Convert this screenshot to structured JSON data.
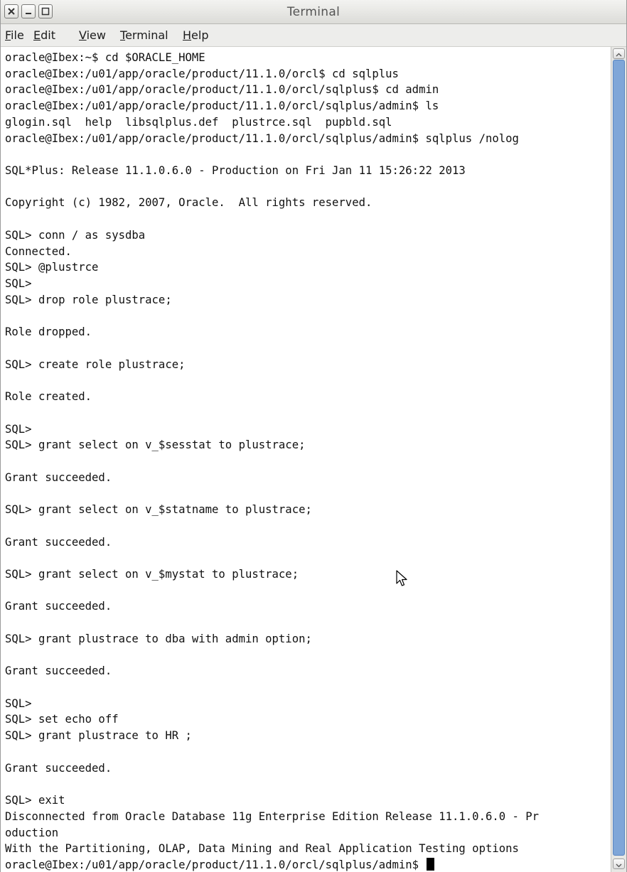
{
  "window": {
    "title": "Terminal"
  },
  "menu": {
    "items": [
      {
        "mnemonic": "F",
        "rest": "ile"
      },
      {
        "mnemonic": "E",
        "rest": "dit"
      },
      {
        "mnemonic": "V",
        "rest": "iew"
      },
      {
        "mnemonic": "T",
        "rest": "erminal"
      },
      {
        "mnemonic": "H",
        "rest": "elp"
      }
    ]
  },
  "icons": {
    "close": "close-icon",
    "minimize": "minimize-icon",
    "maximize": "maximize-icon",
    "pointer": "mouse-pointer-icon"
  },
  "colors": {
    "scrollbar_thumb": "#7fa6d8",
    "terminal_background": "#ffffff",
    "terminal_text": "#111111"
  },
  "terminal": {
    "lines": [
      "oracle@Ibex:~$ cd $ORACLE_HOME",
      "oracle@Ibex:/u01/app/oracle/product/11.1.0/orcl$ cd sqlplus",
      "oracle@Ibex:/u01/app/oracle/product/11.1.0/orcl/sqlplus$ cd admin",
      "oracle@Ibex:/u01/app/oracle/product/11.1.0/orcl/sqlplus/admin$ ls",
      "glogin.sql  help  libsqlplus.def  plustrce.sql  pupbld.sql",
      "oracle@Ibex:/u01/app/oracle/product/11.1.0/orcl/sqlplus/admin$ sqlplus /nolog",
      "",
      "SQL*Plus: Release 11.1.0.6.0 - Production on Fri Jan 11 15:26:22 2013",
      "",
      "Copyright (c) 1982, 2007, Oracle.  All rights reserved.",
      "",
      "SQL> conn / as sysdba",
      "Connected.",
      "SQL> @plustrce",
      "SQL>",
      "SQL> drop role plustrace;",
      "",
      "Role dropped.",
      "",
      "SQL> create role plustrace;",
      "",
      "Role created.",
      "",
      "SQL>",
      "SQL> grant select on v_$sesstat to plustrace;",
      "",
      "Grant succeeded.",
      "",
      "SQL> grant select on v_$statname to plustrace;",
      "",
      "Grant succeeded.",
      "",
      "SQL> grant select on v_$mystat to plustrace;",
      "",
      "Grant succeeded.",
      "",
      "SQL> grant plustrace to dba with admin option;",
      "",
      "Grant succeeded.",
      "",
      "SQL>",
      "SQL> set echo off",
      "SQL> grant plustrace to HR ;",
      "",
      "Grant succeeded.",
      "",
      "SQL> exit",
      "Disconnected from Oracle Database 11g Enterprise Edition Release 11.1.0.6.0 - Pr",
      "oduction",
      "With the Partitioning, OLAP, Data Mining and Real Application Testing options"
    ],
    "prompt": "oracle@Ibex:/u01/app/oracle/product/11.1.0/orcl/sqlplus/admin$ "
  }
}
